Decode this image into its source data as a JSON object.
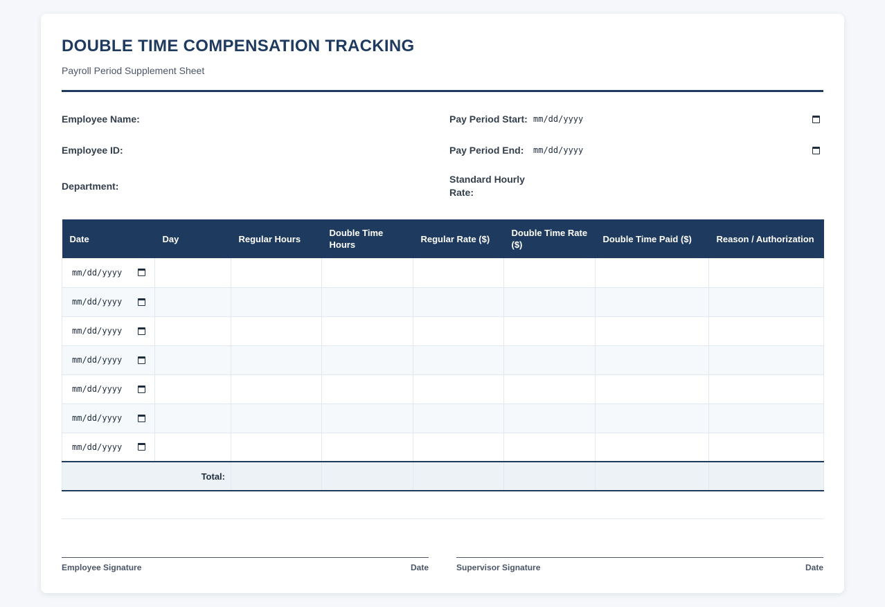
{
  "header": {
    "title": "DOUBLE TIME COMPENSATION TRACKING",
    "subtitle": "Payroll Period Supplement Sheet"
  },
  "fields": {
    "employee_name_label": "Employee Name:",
    "employee_id_label": "Employee ID:",
    "department_label": "Department:",
    "pay_period_start_label": "Pay Period Start:",
    "pay_period_end_label": "Pay Period End:",
    "standard_rate_label_line1": "Standard Hourly",
    "standard_rate_label_line2": "Rate:",
    "date_placeholder": "mm/dd/yyyy"
  },
  "table": {
    "columns": [
      "Date",
      "Day",
      "Regular Hours",
      "Double Time Hours",
      "Regular Rate ($)",
      "Double Time Rate ($)",
      "Double Time Paid ($)",
      "Reason / Authorization"
    ],
    "row_date_placeholders": [
      "mm/dd/yyyy",
      "mm/dd/yyyy",
      "mm/dd/yyyy",
      "mm/dd/yyyy",
      "mm/dd/yyyy",
      "mm/dd/yyyy",
      "mm/dd/yyyy"
    ],
    "total_label": "Total:"
  },
  "signatures": {
    "employee_label": "Employee Signature",
    "employee_date_label": "Date",
    "supervisor_label": "Supervisor Signature",
    "supervisor_date_label": "Date"
  },
  "colors": {
    "primary": "#1e3a5f",
    "row_alt": "#f5f9fc",
    "total_bg": "#edf2f7"
  },
  "icons": {
    "calendar": "calendar-icon"
  }
}
